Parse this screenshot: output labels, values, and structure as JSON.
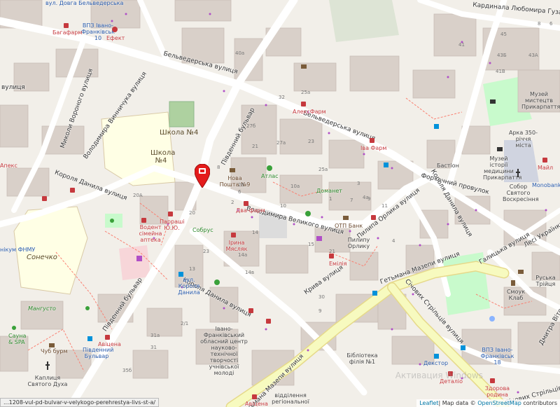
{
  "streets": {
    "belvederska_1": "Бельведерська вулиця",
    "belvederska_2": "Бельведерська вулиця",
    "kardynala": "Кардинала Любомира Гузара вулиця",
    "pivdennyi_1": "Південний бульвар",
    "pivdennyi_2": "Південний бульвар",
    "volodymyra_velykoho": "Володимира Великого вулиця",
    "danyla_1": "Короля Данила вулиця",
    "danyla_2": "Короля Данила вулиця",
    "danyla_3": "Короля Данила вулиця",
    "mykoly": "Миколи Вороного вулиця",
    "volodymyra_vynnyc": "Володимира Винничука вулиця",
    "orlyka": "Пилипа Орлика вулиця",
    "fortechnyi": "Фортечний провулок",
    "galytska": "Галицька вулиця",
    "mazepy_1": "Гетьмана Мазепи вулиця",
    "mazepy_2": "Гетьмана Мазепи вулиця",
    "sichovyh_1": "Січових Стрільців вулиця",
    "sichovyh_2": "Січових Стрільців вулиця",
    "kryva": "Крива вулиця",
    "vypanskoho": "Дмитра Вітовського вулиця",
    "left_vul": "вулиця",
    "les_ukr": "Лесі Українки"
  },
  "pois": {
    "apteka_top": "вул. Довга Бельведерська",
    "vpz_top": "ВПЗ Івано-Франківськ 10",
    "bagafarm": "Багафарм",
    "efekt": "Ефект",
    "alexfarm": "АлексФарм",
    "iva_farm": "Іва Фарм",
    "shkola_4a": "Школа №4",
    "shkola_4b": "Школа №4",
    "nova_poshta": "Нова Пошта №9",
    "atlas": "Атлас",
    "domanet": "Доманет",
    "dvafarm": "Два-фарм",
    "otp": "ОТП Банк",
    "pylypa": "Пилипу Орлику",
    "apteka_sr": "Водент сімейна аптека",
    "pharm_yu": "Парраші Ю.Ю.",
    "sobrus": "Собрус",
    "iryna": "Ірина Мясляк",
    "sonechko": "Сонечко",
    "mangusto": "Мангусто",
    "sauna": "Сауна & SPA",
    "chubburm": "Чуб бурм",
    "avicena_1": "Авіцена",
    "pivdennyi_bus": "Південний Бульвар",
    "kaplycya": "Каплиця Святого Духа",
    "vul_danyla": "вул. Короля Данила",
    "centre": "Івано-Франківський обласний центр науково-технічної творчості учнівської молоді",
    "biblioteka": "Бібліотека філія №1",
    "vpz_bottom": "ВПЗ Івано-Франківськ 18",
    "zdorova": "Здорова родина",
    "avicena_2": "Авіцена",
    "viddil": "відділення регіональної",
    "emilia": "Емілія",
    "muzei_1": "Музей мистецтв Прикарпаття",
    "arka": "Арка 350-річчя міста",
    "bastion": "Бастіон",
    "muzei_2": "Музей історії медицини Прикарпаття",
    "sobor": "Собор Святого Воскресіння",
    "smoky": "Смоук Клаб",
    "ruska": "Руська Трійця",
    "dextor": "Декстор",
    "detalio": "Деталіо",
    "monobank": "Monobank",
    "mayl": "Майл",
    "shool_left": "Апекс",
    "left_npu": "нікум ФНМУ"
  },
  "house_numbers": [
    "40а",
    "32",
    "25а",
    "27б",
    "27а",
    "23",
    "21",
    "25а",
    "10а",
    "4а",
    "8",
    "6",
    "10",
    "14",
    "14а",
    "14в",
    "13",
    "20А",
    "31а",
    "31",
    "20",
    "35б",
    "26",
    "2",
    "1",
    "3",
    "9",
    "11",
    "7",
    "15",
    "21",
    "23",
    "2/1",
    "4",
    "30",
    "9",
    "41",
    "43Б",
    "43А",
    "41В",
    "45",
    "8",
    "6"
  ],
  "attribution": {
    "leaflet": "Leaflet",
    "text": "| Map data © ",
    "osm": "OpenStreetMap",
    "contrib": " contributors"
  },
  "url_fragment": "...1208-vul-pd-bulvar-v-velykogo-perehrestya-livs-st-a/",
  "watermark": "Активация Windows",
  "colors": {
    "background": "#f2efe9",
    "building": "#d9d0c9",
    "road_white": "#ffffff",
    "road_yellow": "#f7fabf",
    "school_area": "#ffffe5",
    "park": "#c8facc",
    "pin": "#e41b1b"
  }
}
